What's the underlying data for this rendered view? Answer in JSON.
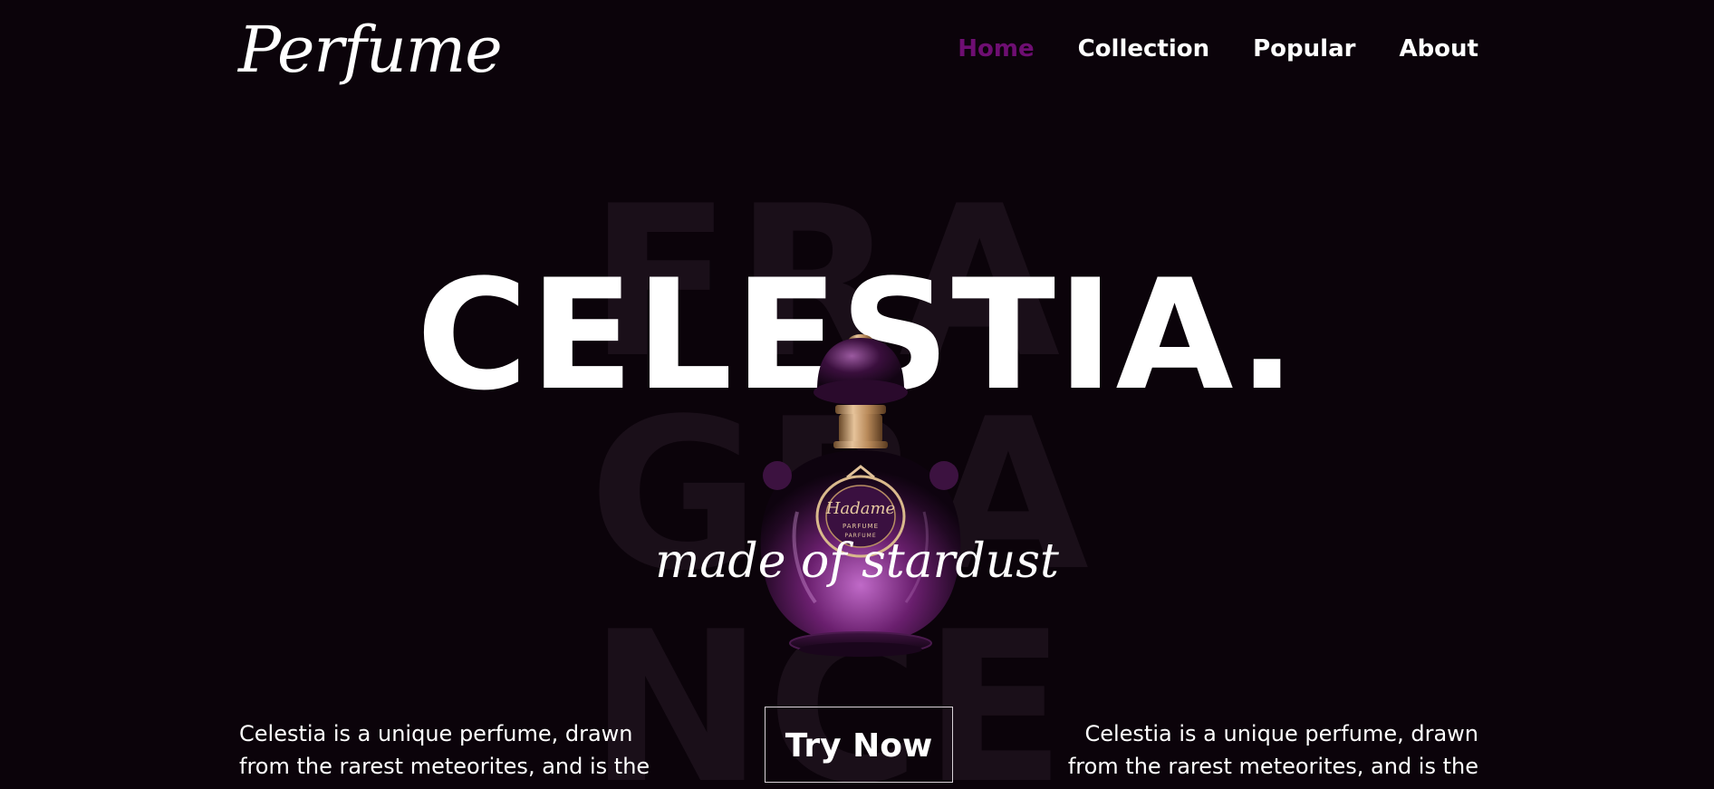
{
  "brand": {
    "logo": "Perfume"
  },
  "nav": {
    "items": [
      {
        "label": "Home",
        "active": true
      },
      {
        "label": "Collection",
        "active": false
      },
      {
        "label": "Popular",
        "active": false
      },
      {
        "label": "About",
        "active": false
      }
    ]
  },
  "hero": {
    "watermark": "FRAGRANCE",
    "title": "CELESTIA.",
    "tagline": "made of stardust",
    "description_left": "Celestia is a unique perfume, drawn from the rarest meteorites, and is the only one to be sourced from the stars.",
    "description_right": "Celestia is a unique perfume, drawn from the rarest meteorites, and is the only one to be sourced from the stars.",
    "cta_label": "Try Now",
    "bottle_label": {
      "brand": "Hadame",
      "line1": "PARFUME",
      "line2": "PARFUME"
    }
  },
  "colors": {
    "background": "#0b030a",
    "accent": "#6e0e72",
    "watermark": "#1a0f19",
    "text": "#ffffff"
  }
}
